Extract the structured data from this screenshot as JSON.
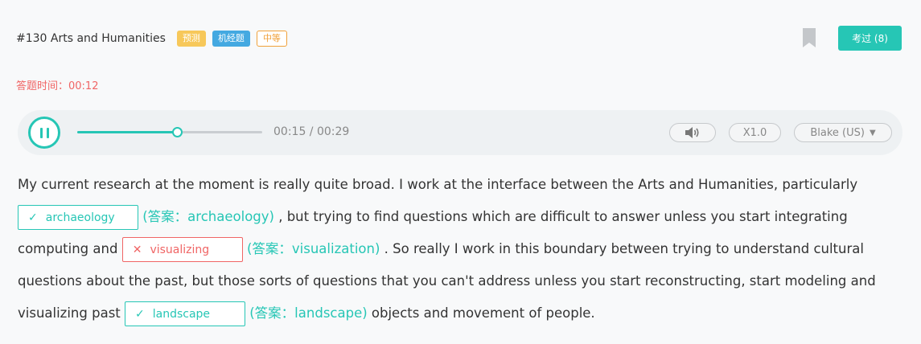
{
  "header": {
    "title": "#130 Arts and Humanities",
    "tags": [
      "预测",
      "机经题",
      "中等"
    ],
    "exam_button": "考过 (8)"
  },
  "timer": "答题时间：00:12",
  "player": {
    "time": "00:15 / 00:29",
    "progress": 0.54,
    "speed": "X1.0",
    "voice": "Blake (US)"
  },
  "passage": {
    "p1": "My current research at the moment is really quite broad. I work at the interface between the Arts and Humanities, particularly ",
    "blank1": {
      "input": "archaeology",
      "answer": "(答案：archaeology)"
    },
    "p2": " , but trying to find questions which are difficult to answer unless you start integrating computing and ",
    "blank2": {
      "input": "visualizing",
      "answer": "(答案：visualization)"
    },
    "p3": " . So really I work in this boundary between trying to understand cultural questions about the past, but those sorts of questions that you can't address unless you start reconstructing, start modeling and visualizing past ",
    "blank3": {
      "input": "landscape",
      "answer": "(答案：landscape)"
    },
    "p4": " objects and movement of people."
  },
  "colors": {
    "accent": "#26c6b5",
    "error": "#f06565",
    "tag_predict": "#f7c85a",
    "tag_machine": "#44a9e1",
    "tag_level": "#f0a13a"
  }
}
